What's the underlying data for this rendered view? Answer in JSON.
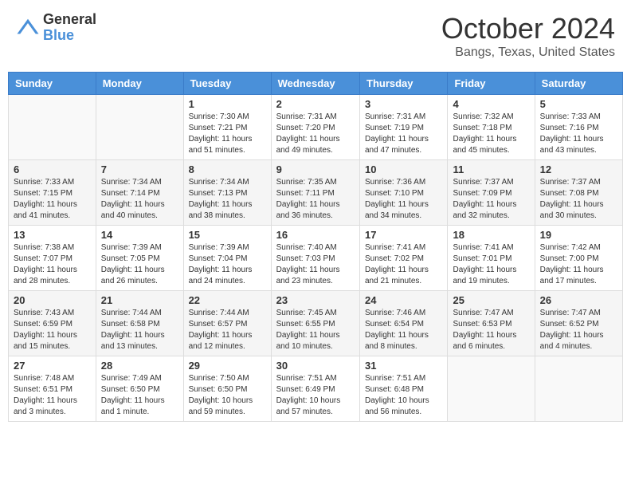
{
  "header": {
    "logo_general": "General",
    "logo_blue": "Blue",
    "month": "October 2024",
    "location": "Bangs, Texas, United States"
  },
  "days_of_week": [
    "Sunday",
    "Monday",
    "Tuesday",
    "Wednesday",
    "Thursday",
    "Friday",
    "Saturday"
  ],
  "weeks": [
    [
      {
        "day": "",
        "info": ""
      },
      {
        "day": "",
        "info": ""
      },
      {
        "day": "1",
        "info": "Sunrise: 7:30 AM\nSunset: 7:21 PM\nDaylight: 11 hours and 51 minutes."
      },
      {
        "day": "2",
        "info": "Sunrise: 7:31 AM\nSunset: 7:20 PM\nDaylight: 11 hours and 49 minutes."
      },
      {
        "day": "3",
        "info": "Sunrise: 7:31 AM\nSunset: 7:19 PM\nDaylight: 11 hours and 47 minutes."
      },
      {
        "day": "4",
        "info": "Sunrise: 7:32 AM\nSunset: 7:18 PM\nDaylight: 11 hours and 45 minutes."
      },
      {
        "day": "5",
        "info": "Sunrise: 7:33 AM\nSunset: 7:16 PM\nDaylight: 11 hours and 43 minutes."
      }
    ],
    [
      {
        "day": "6",
        "info": "Sunrise: 7:33 AM\nSunset: 7:15 PM\nDaylight: 11 hours and 41 minutes."
      },
      {
        "day": "7",
        "info": "Sunrise: 7:34 AM\nSunset: 7:14 PM\nDaylight: 11 hours and 40 minutes."
      },
      {
        "day": "8",
        "info": "Sunrise: 7:34 AM\nSunset: 7:13 PM\nDaylight: 11 hours and 38 minutes."
      },
      {
        "day": "9",
        "info": "Sunrise: 7:35 AM\nSunset: 7:11 PM\nDaylight: 11 hours and 36 minutes."
      },
      {
        "day": "10",
        "info": "Sunrise: 7:36 AM\nSunset: 7:10 PM\nDaylight: 11 hours and 34 minutes."
      },
      {
        "day": "11",
        "info": "Sunrise: 7:37 AM\nSunset: 7:09 PM\nDaylight: 11 hours and 32 minutes."
      },
      {
        "day": "12",
        "info": "Sunrise: 7:37 AM\nSunset: 7:08 PM\nDaylight: 11 hours and 30 minutes."
      }
    ],
    [
      {
        "day": "13",
        "info": "Sunrise: 7:38 AM\nSunset: 7:07 PM\nDaylight: 11 hours and 28 minutes."
      },
      {
        "day": "14",
        "info": "Sunrise: 7:39 AM\nSunset: 7:05 PM\nDaylight: 11 hours and 26 minutes."
      },
      {
        "day": "15",
        "info": "Sunrise: 7:39 AM\nSunset: 7:04 PM\nDaylight: 11 hours and 24 minutes."
      },
      {
        "day": "16",
        "info": "Sunrise: 7:40 AM\nSunset: 7:03 PM\nDaylight: 11 hours and 23 minutes."
      },
      {
        "day": "17",
        "info": "Sunrise: 7:41 AM\nSunset: 7:02 PM\nDaylight: 11 hours and 21 minutes."
      },
      {
        "day": "18",
        "info": "Sunrise: 7:41 AM\nSunset: 7:01 PM\nDaylight: 11 hours and 19 minutes."
      },
      {
        "day": "19",
        "info": "Sunrise: 7:42 AM\nSunset: 7:00 PM\nDaylight: 11 hours and 17 minutes."
      }
    ],
    [
      {
        "day": "20",
        "info": "Sunrise: 7:43 AM\nSunset: 6:59 PM\nDaylight: 11 hours and 15 minutes."
      },
      {
        "day": "21",
        "info": "Sunrise: 7:44 AM\nSunset: 6:58 PM\nDaylight: 11 hours and 13 minutes."
      },
      {
        "day": "22",
        "info": "Sunrise: 7:44 AM\nSunset: 6:57 PM\nDaylight: 11 hours and 12 minutes."
      },
      {
        "day": "23",
        "info": "Sunrise: 7:45 AM\nSunset: 6:55 PM\nDaylight: 11 hours and 10 minutes."
      },
      {
        "day": "24",
        "info": "Sunrise: 7:46 AM\nSunset: 6:54 PM\nDaylight: 11 hours and 8 minutes."
      },
      {
        "day": "25",
        "info": "Sunrise: 7:47 AM\nSunset: 6:53 PM\nDaylight: 11 hours and 6 minutes."
      },
      {
        "day": "26",
        "info": "Sunrise: 7:47 AM\nSunset: 6:52 PM\nDaylight: 11 hours and 4 minutes."
      }
    ],
    [
      {
        "day": "27",
        "info": "Sunrise: 7:48 AM\nSunset: 6:51 PM\nDaylight: 11 hours and 3 minutes."
      },
      {
        "day": "28",
        "info": "Sunrise: 7:49 AM\nSunset: 6:50 PM\nDaylight: 11 hours and 1 minute."
      },
      {
        "day": "29",
        "info": "Sunrise: 7:50 AM\nSunset: 6:50 PM\nDaylight: 10 hours and 59 minutes."
      },
      {
        "day": "30",
        "info": "Sunrise: 7:51 AM\nSunset: 6:49 PM\nDaylight: 10 hours and 57 minutes."
      },
      {
        "day": "31",
        "info": "Sunrise: 7:51 AM\nSunset: 6:48 PM\nDaylight: 10 hours and 56 minutes."
      },
      {
        "day": "",
        "info": ""
      },
      {
        "day": "",
        "info": ""
      }
    ]
  ]
}
